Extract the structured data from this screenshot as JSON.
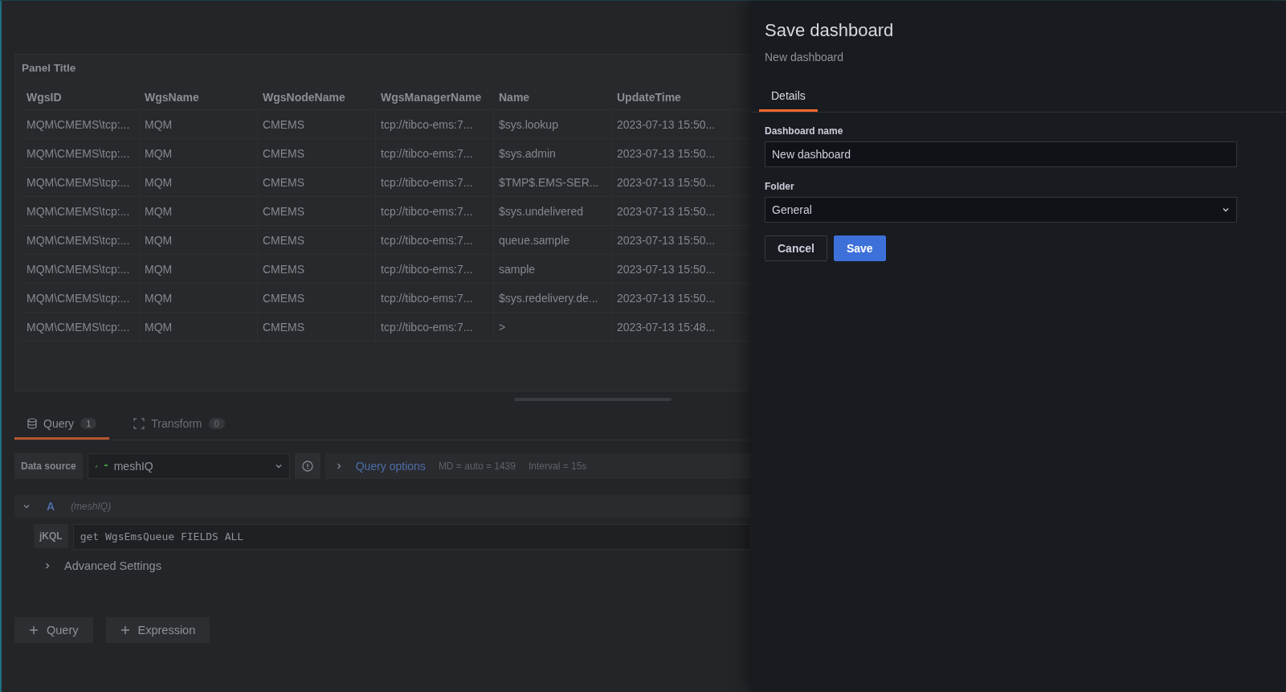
{
  "panel": {
    "title": "Panel Title",
    "table": {
      "columns": [
        "WgsID",
        "WgsName",
        "WgsNodeName",
        "WgsManagerName",
        "Name",
        "UpdateTime"
      ],
      "rows": [
        [
          "MQM\\CMEMS\\tcp:...",
          "MQM",
          "CMEMS",
          "tcp://tibco-ems:7...",
          "$sys.lookup",
          "2023-07-13 15:50..."
        ],
        [
          "MQM\\CMEMS\\tcp:...",
          "MQM",
          "CMEMS",
          "tcp://tibco-ems:7...",
          "$sys.admin",
          "2023-07-13 15:50..."
        ],
        [
          "MQM\\CMEMS\\tcp:...",
          "MQM",
          "CMEMS",
          "tcp://tibco-ems:7...",
          "$TMP$.EMS-SER...",
          "2023-07-13 15:50..."
        ],
        [
          "MQM\\CMEMS\\tcp:...",
          "MQM",
          "CMEMS",
          "tcp://tibco-ems:7...",
          "$sys.undelivered",
          "2023-07-13 15:50..."
        ],
        [
          "MQM\\CMEMS\\tcp:...",
          "MQM",
          "CMEMS",
          "tcp://tibco-ems:7...",
          "queue.sample",
          "2023-07-13 15:50..."
        ],
        [
          "MQM\\CMEMS\\tcp:...",
          "MQM",
          "CMEMS",
          "tcp://tibco-ems:7...",
          "sample",
          "2023-07-13 15:50..."
        ],
        [
          "MQM\\CMEMS\\tcp:...",
          "MQM",
          "CMEMS",
          "tcp://tibco-ems:7...",
          "$sys.redelivery.de...",
          "2023-07-13 15:50..."
        ],
        [
          "MQM\\CMEMS\\tcp:...",
          "MQM",
          "CMEMS",
          "tcp://tibco-ems:7...",
          ">",
          "2023-07-13 15:48..."
        ]
      ]
    }
  },
  "query_editor": {
    "tabs": [
      {
        "label": "Query",
        "count": "1",
        "selected": true
      },
      {
        "label": "Transform",
        "count": "0",
        "selected": false
      }
    ],
    "data_source": {
      "label": "Data source",
      "value": "meshIQ"
    },
    "query_options": {
      "label": "Query options",
      "max_data_points": "MD = auto = 1439",
      "interval": "Interval = 15s"
    },
    "queries": [
      {
        "ref": "A",
        "source": "(meshIQ)",
        "expanded": true,
        "language": "jKQL",
        "text": "get WgsEmsQueue FIELDS ALL",
        "advanced": "Advanced Settings"
      }
    ],
    "add_buttons": [
      "Query",
      "Expression"
    ]
  },
  "drawer": {
    "title": "Save dashboard",
    "subtitle": "New dashboard",
    "tabs": [
      {
        "label": "Details",
        "selected": true
      }
    ],
    "fields": [
      {
        "kind": "text",
        "label": "Dashboard name",
        "value": "New dashboard"
      },
      {
        "kind": "select",
        "label": "Folder",
        "value": "General"
      }
    ],
    "buttons": [
      {
        "label": "Cancel",
        "kind": "secondary"
      },
      {
        "label": "Save",
        "kind": "primary"
      }
    ]
  }
}
